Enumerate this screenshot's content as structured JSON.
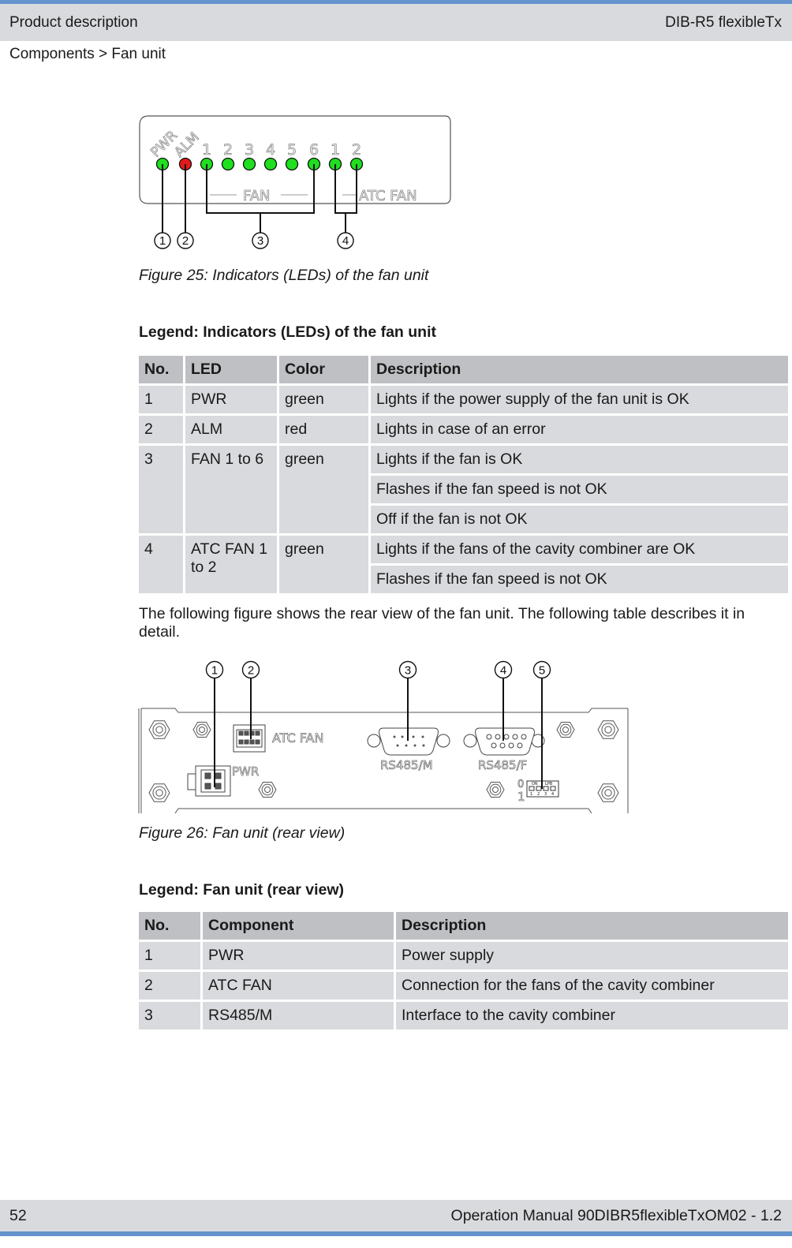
{
  "header": {
    "section": "Product description",
    "product": "DIB-R5 flexibleTx"
  },
  "breadcrumb": "Components > Fan unit",
  "figure25": {
    "caption": "Figure 25: Indicators (LEDs) of the fan unit",
    "panel_labels": {
      "pwr": "PWR",
      "alm": "ALM",
      "fan_numbers": [
        "1",
        "2",
        "3",
        "4",
        "5",
        "6"
      ],
      "atc_numbers": [
        "1",
        "2"
      ],
      "fan_group": "FAN",
      "atc_group": "ATC FAN"
    },
    "leds": [
      {
        "name": "PWR",
        "color": "#1ee01e"
      },
      {
        "name": "ALM",
        "color": "#e41a1a"
      },
      {
        "name": "FAN 1",
        "color": "#1ee01e"
      },
      {
        "name": "FAN 2",
        "color": "#1ee01e"
      },
      {
        "name": "FAN 3",
        "color": "#1ee01e"
      },
      {
        "name": "FAN 4",
        "color": "#1ee01e"
      },
      {
        "name": "FAN 5",
        "color": "#1ee01e"
      },
      {
        "name": "FAN 6",
        "color": "#1ee01e"
      },
      {
        "name": "ATC FAN 1",
        "color": "#1ee01e"
      },
      {
        "name": "ATC FAN 2",
        "color": "#1ee01e"
      }
    ],
    "callouts": [
      "1",
      "2",
      "3",
      "4"
    ]
  },
  "legend1": {
    "title": "Legend: Indicators (LEDs) of the fan unit",
    "headers": [
      "No.",
      "LED",
      "Color",
      "Description"
    ],
    "rows": [
      {
        "no": "1",
        "led": "PWR",
        "color": "green",
        "descriptions": [
          "Lights if the power supply of the fan unit is OK"
        ]
      },
      {
        "no": "2",
        "led": "ALM",
        "color": "red",
        "descriptions": [
          "Lights in case of an error"
        ]
      },
      {
        "no": "3",
        "led": "FAN 1 to 6",
        "color": "green",
        "descriptions": [
          "Lights if the fan is OK",
          "Flashes if the fan speed is not OK",
          "Off if the fan is not OK"
        ]
      },
      {
        "no": "4",
        "led": "ATC FAN 1 to 2",
        "color": "green",
        "descriptions": [
          "Lights if the fans of the cavity combiner are OK",
          "Flashes if the fan speed is not OK"
        ]
      }
    ]
  },
  "paragraph": "The following figure shows the rear view of the fan unit. The following table describes it in detail.",
  "figure26": {
    "caption": "Figure 26: Fan unit (rear view)",
    "callouts": [
      "1",
      "2",
      "3",
      "4",
      "5"
    ],
    "labels": {
      "atc_fan": "ATC FAN",
      "pwr": "PWR",
      "rs485m": "RS485/M",
      "rs485f": "RS485/F",
      "dip_off": "0",
      "dip_on": "1",
      "dip_header_left": "ON",
      "dip_header_right": "LPB",
      "dip_numbers": [
        "1",
        "2",
        "3",
        "4"
      ]
    }
  },
  "legend2": {
    "title": "Legend: Fan unit (rear view)",
    "headers": [
      "No.",
      "Component",
      "Description"
    ],
    "rows": [
      {
        "no": "1",
        "component": "PWR",
        "description": "Power supply"
      },
      {
        "no": "2",
        "component": "ATC FAN",
        "description": "Connection for the fans of the cavity combiner"
      },
      {
        "no": "3",
        "component": "RS485/M",
        "description": "Interface to the cavity combiner"
      }
    ]
  },
  "footer": {
    "page_number": "52",
    "document": "Operation Manual 90DIBR5flexibleTxOM02 - 1.2"
  },
  "colors": {
    "accent_bar": "#6593cb",
    "header_bg": "#d9dadd",
    "table_header_bg": "#bfc0c3",
    "table_cell_bg": "#d9dadd"
  }
}
